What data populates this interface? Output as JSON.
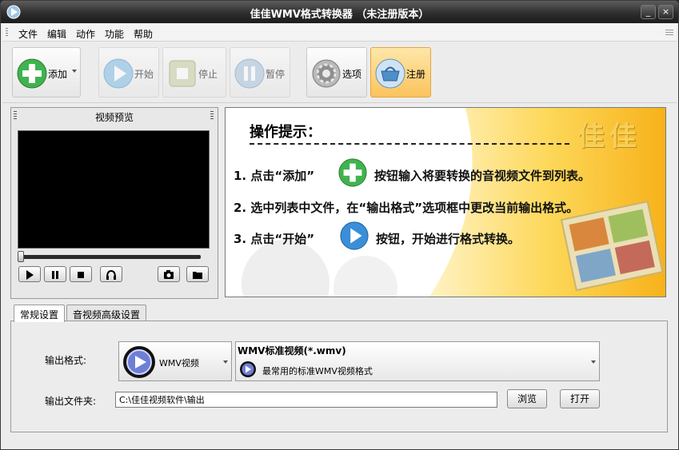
{
  "window": {
    "title": "佳佳WMV格式转换器  （未注册版本）"
  },
  "titlebar": {
    "minimize_label": "_",
    "close_label": "×"
  },
  "menu": {
    "items": [
      "文件",
      "编辑",
      "动作",
      "功能",
      "帮助"
    ]
  },
  "toolbar": {
    "add": {
      "label": "添加",
      "icon": "plus-icon"
    },
    "start": {
      "label": "开始",
      "icon": "play-icon"
    },
    "stop": {
      "label": "停止",
      "icon": "stop-icon"
    },
    "pause": {
      "label": "暂停",
      "icon": "pause-icon"
    },
    "options": {
      "label": "选项",
      "icon": "gear-icon"
    },
    "register": {
      "label": "注册",
      "icon": "basket-icon"
    }
  },
  "preview": {
    "title": "视频预览",
    "progress": 0
  },
  "tips": {
    "heading": "操作提示：",
    "brand": "佳佳",
    "line1_a": "1. 点击“添加”",
    "line1_b": "按钮输入将要转换的音视频文件到列表。",
    "line2": "2. 选中列表中文件，在“输出格式”选项框中更改当前输出格式。",
    "line3_a": "3. 点击“开始”",
    "line3_b": "按钮，开始进行格式转换。"
  },
  "tabs": [
    {
      "label": "常规设置",
      "selected": true
    },
    {
      "label": "音视频高级设置",
      "selected": false
    }
  ],
  "settings": {
    "output_format_label": "输出格式:",
    "format_combo_value": "WMV视频",
    "format_desc_title": "WMV标准视频(*.wmv)",
    "format_desc_sub": "最常用的标准WMV视频格式",
    "output_folder_label": "输出文件夹:",
    "output_folder_value": "C:\\佳佳视频软件\\输出",
    "browse_label": "浏览",
    "open_label": "打开"
  },
  "colors": {
    "accent_orange": "#fbc35d",
    "play_blue": "#3a8fd8",
    "add_green": "#3fb34f"
  }
}
